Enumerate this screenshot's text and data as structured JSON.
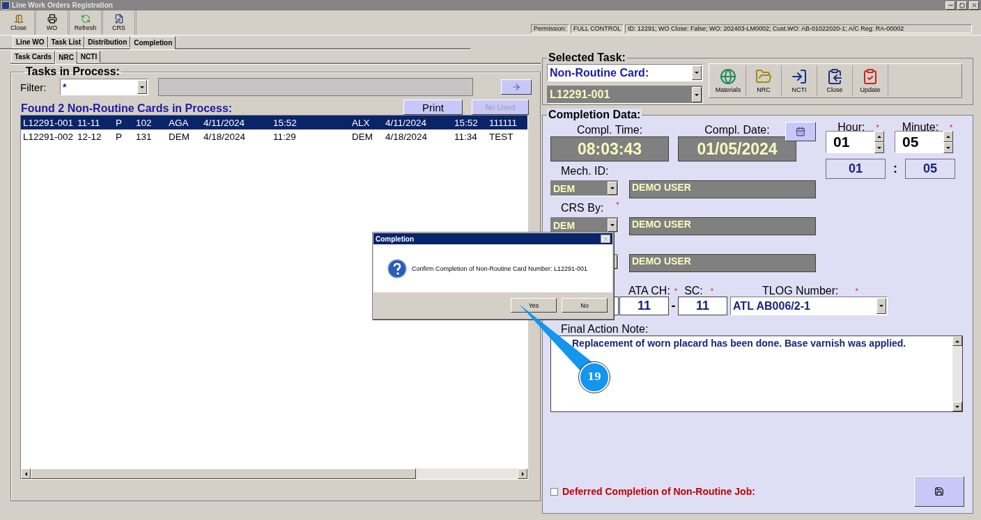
{
  "window": {
    "title": "Line Work Orders Registration"
  },
  "toolbar": [
    {
      "label": "Close",
      "kind": "close"
    },
    {
      "label": "WO",
      "kind": "wo"
    },
    {
      "label": "Refresh",
      "kind": "refresh"
    },
    {
      "label": "CRS",
      "kind": "crs"
    }
  ],
  "status": {
    "permission_label": "Permission:",
    "permission": "FULL CONTROL",
    "info": "ID: 12291; WO Close: False; WO: 202403-LM0002; Cust.WO: AB-01022020-1; A/C Reg: RA-00002"
  },
  "tabs": [
    {
      "label": "Line WO",
      "selected": false
    },
    {
      "label": "Task List",
      "selected": false
    },
    {
      "label": "Distribution",
      "selected": false
    },
    {
      "label": "Completion",
      "selected": true
    }
  ],
  "subtabs": [
    {
      "label": "Task Cards",
      "selected": false
    },
    {
      "label": "NRC",
      "selected": true
    },
    {
      "label": "NCTI",
      "selected": false
    }
  ],
  "tasks_panel": {
    "title": "Tasks in Process:",
    "filter_label": "Filter:",
    "filter_value": "*",
    "found_text": "Found 2 Non-Routine Cards in Process:",
    "print": "Print",
    "no_used": {
      "label": "No Used",
      "disabled": true
    },
    "rows": [
      {
        "selected": true,
        "cells": [
          "L12291-001",
          "11-11",
          "P",
          "102",
          "AGA",
          "4/11/2024",
          "15:52",
          "ALX",
          "4/11/2024",
          "15:52",
          "111111"
        ]
      },
      {
        "selected": false,
        "cells": [
          "L12291-002",
          "12-12",
          "P",
          "131",
          "DEM",
          "4/18/2024",
          "11:29",
          "DEM",
          "4/18/2024",
          "11:34",
          "TEST"
        ]
      }
    ]
  },
  "selected_task": {
    "title": "Selected Task:",
    "type": "Non-Routine Card:",
    "card": "L12291-001",
    "buttons": [
      {
        "label": "Materials",
        "kind": "materials"
      },
      {
        "label": "NRC",
        "kind": "nrc"
      },
      {
        "label": "NCTI",
        "kind": "ncti"
      },
      {
        "label": "Close",
        "kind": "close"
      },
      {
        "label": "Update",
        "kind": "update"
      }
    ]
  },
  "completion": {
    "title": "Completion Data:",
    "required_mark": "*",
    "time_label": "Compl. Time:",
    "time": "08:03:43",
    "date_label": "Compl. Date:",
    "date": "01/05/2024",
    "hour_label": "Hour:",
    "hour": "01",
    "minute_label": "Minute:",
    "minute": "05",
    "hour_display": "01",
    "separator": ":",
    "minute_display": "05",
    "people": [
      {
        "label": "Mech. ID:",
        "required": false,
        "code": "DEM",
        "name": "DEMO USER"
      },
      {
        "label": "CRS By:",
        "required": true,
        "code": "DEM",
        "name": "DEMO USER"
      },
      {
        "name": "DEMO USER"
      }
    ],
    "ata_label": "ATA CH:",
    "ata": "11",
    "dash": "-",
    "sc_label": "SC:",
    "sc": "11",
    "tlog_label": "TLOG Number:",
    "tlog": "ATL AB006/2-1",
    "note_label": "Final Action Note:",
    "note": "Replacement of worn placard has been done. Base varnish was applied.",
    "deferred": {
      "label": "Deferred Completion of Non-Routine Job:",
      "checked": false
    }
  },
  "dialog": {
    "title": "Completion",
    "message": "Confirm Completion of Non-Routine Card Number: L12291-001",
    "buttons": [
      "Yes",
      "No"
    ]
  },
  "callout": {
    "number": "19"
  }
}
